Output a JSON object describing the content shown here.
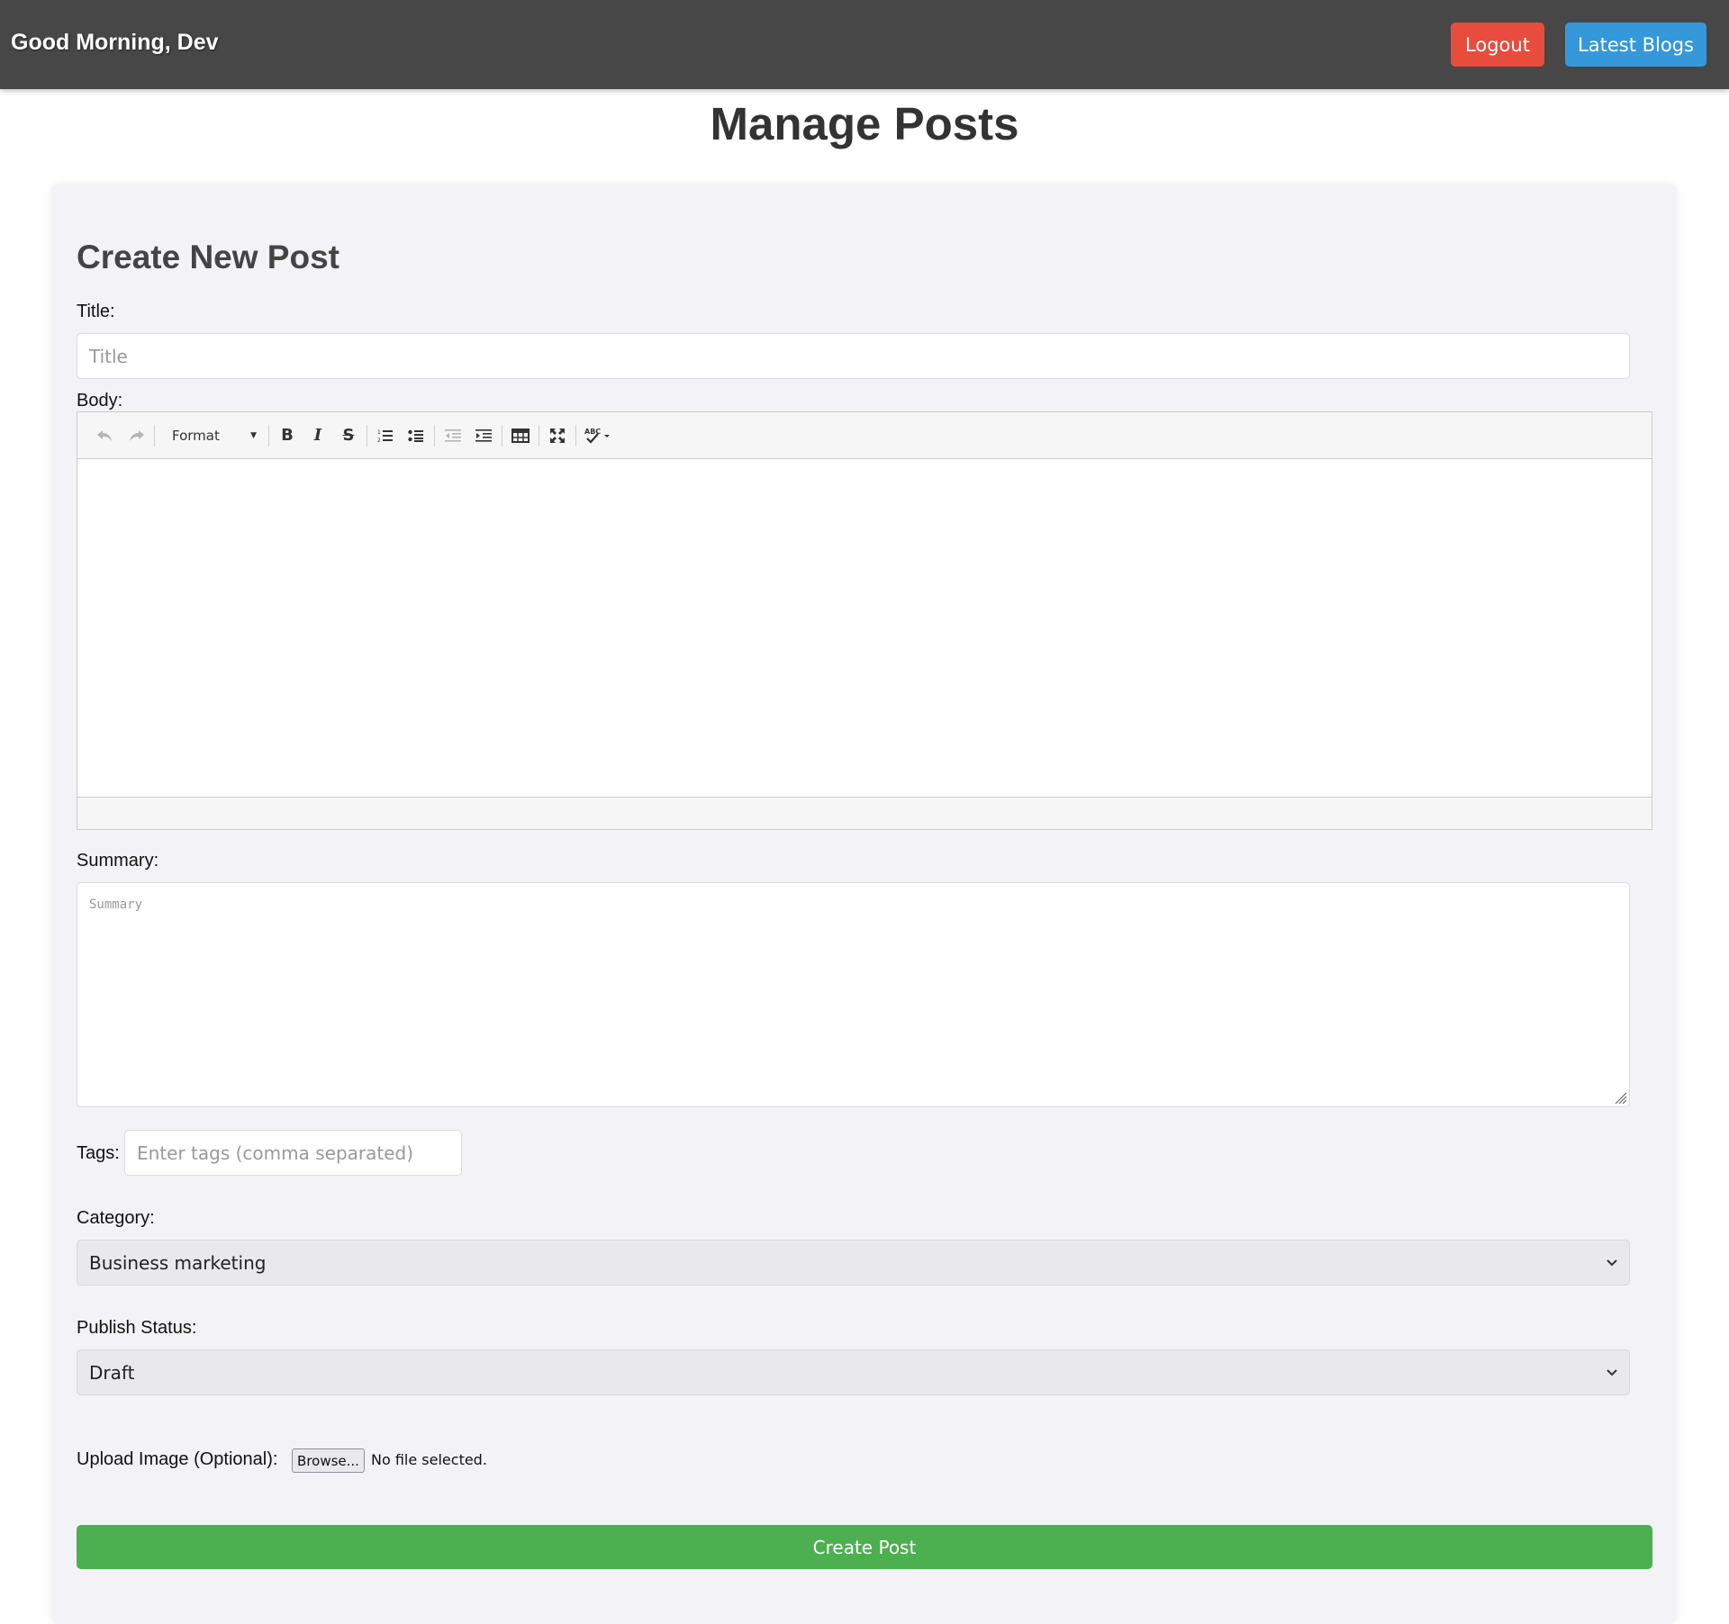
{
  "header": {
    "greeting": "Good Morning, Dev",
    "logout_label": "Logout",
    "latest_blogs_label": "Latest Blogs"
  },
  "page": {
    "title": "Manage Posts"
  },
  "form": {
    "heading": "Create New Post",
    "title_label": "Title:",
    "title_placeholder": "Title",
    "title_value": "",
    "body_label": "Body:",
    "editor_toolbar": {
      "format_label": "Format",
      "buttons": [
        "undo-icon",
        "redo-icon",
        "bold-icon",
        "italic-icon",
        "strikethrough-icon",
        "numbered-list-icon",
        "bullet-list-icon",
        "outdent-icon",
        "indent-icon",
        "table-icon",
        "fullscreen-icon",
        "spellcheck-icon"
      ]
    },
    "body_value": "",
    "summary_label": "Summary:",
    "summary_placeholder": "Summary",
    "tags_label": "Tags:",
    "tags_placeholder": "Enter tags (comma separated)",
    "category_label": "Category:",
    "category_selected": "Business marketing",
    "status_label": "Publish Status:",
    "status_selected": "Draft",
    "upload_label": "Upload Image (Optional):",
    "browse_label": "Browse...",
    "no_file_text": "No file selected.",
    "submit_label": "Create Post"
  },
  "colors": {
    "header_bg": "#474747",
    "logout": "#e74c3c",
    "latest_blogs": "#3498db",
    "submit": "#4caf50",
    "card_bg": "#f3f3f7"
  }
}
